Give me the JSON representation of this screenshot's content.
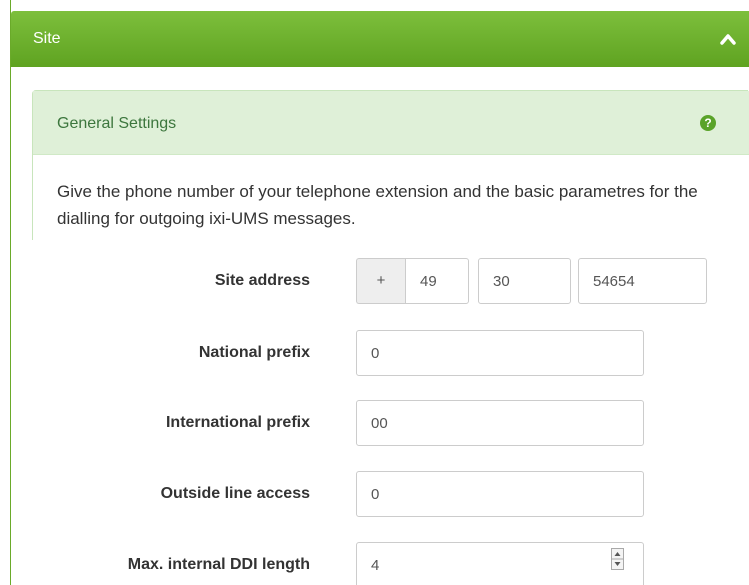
{
  "panel": {
    "title": "Site"
  },
  "section": {
    "title": "General Settings",
    "description": "Give the phone number of your telephone extension and the basic parametres for the dialling for outgoing ixi-UMS messages."
  },
  "form": {
    "site_address": {
      "label": "Site address",
      "prefix": "+",
      "country_code": "49",
      "area_code": "30",
      "number": "54654"
    },
    "national_prefix": {
      "label": "National prefix",
      "value": "0"
    },
    "international_prefix": {
      "label": "International prefix",
      "value": "00"
    },
    "outside_line_access": {
      "label": "Outside line access",
      "value": "0"
    },
    "max_internal_ddi_length": {
      "label": "Max. internal DDI length",
      "value": "4"
    }
  },
  "colors": {
    "accent": "#5fa321",
    "section_bg": "#dff0d8",
    "section_text": "#3c763d"
  },
  "icons": {
    "collapse": "chevron-up-icon",
    "help": "question-circle-icon",
    "spinner": "spinner-arrows-icon"
  }
}
